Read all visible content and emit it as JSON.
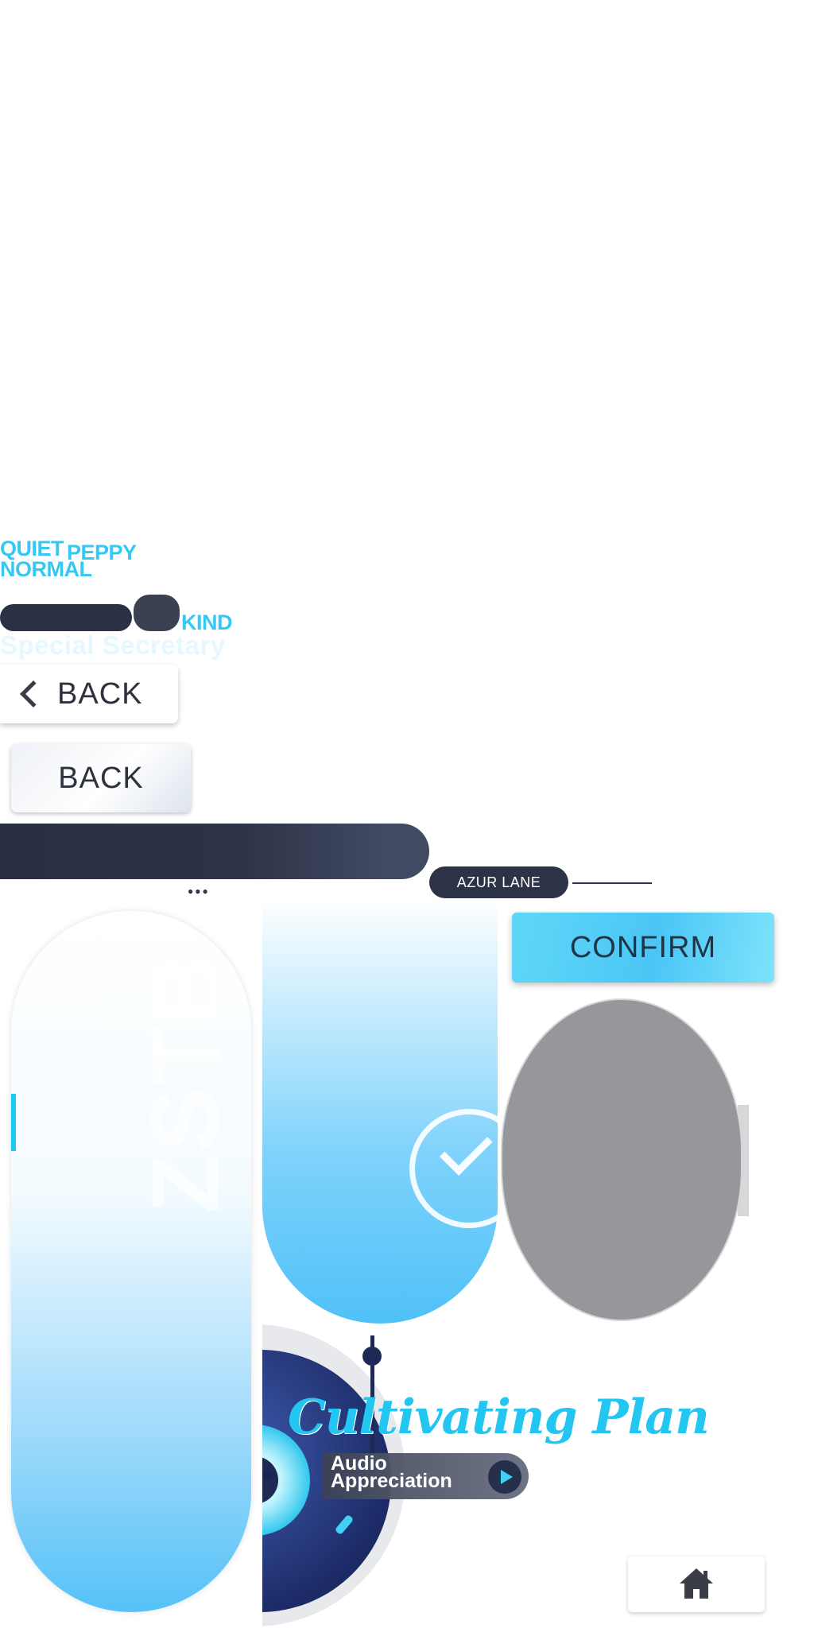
{
  "personality_tags": {
    "quiet": "QUIET",
    "peppy": "PEPPY",
    "normal": "NORMAL",
    "kind": "KIND"
  },
  "special_secretary": "Special Secretary",
  "back_button": {
    "label": "BACK",
    "icon": "chevron-left-icon"
  },
  "back_button_alt": {
    "label": "BACK"
  },
  "brand_tag": "AZUR LANE",
  "confirm_button": {
    "label": "CONFIRM"
  },
  "capsule_watermark": "ZSTB",
  "audio": {
    "title": "Cultivating Plan",
    "label_line1": "Audio",
    "label_line2": "Appreciation",
    "play_icon": "play-icon"
  },
  "home_button": {
    "icon": "home-icon"
  },
  "colors": {
    "accent": "#35c8f2",
    "dark": "#2b3144",
    "gray_panel": "#96979b"
  }
}
